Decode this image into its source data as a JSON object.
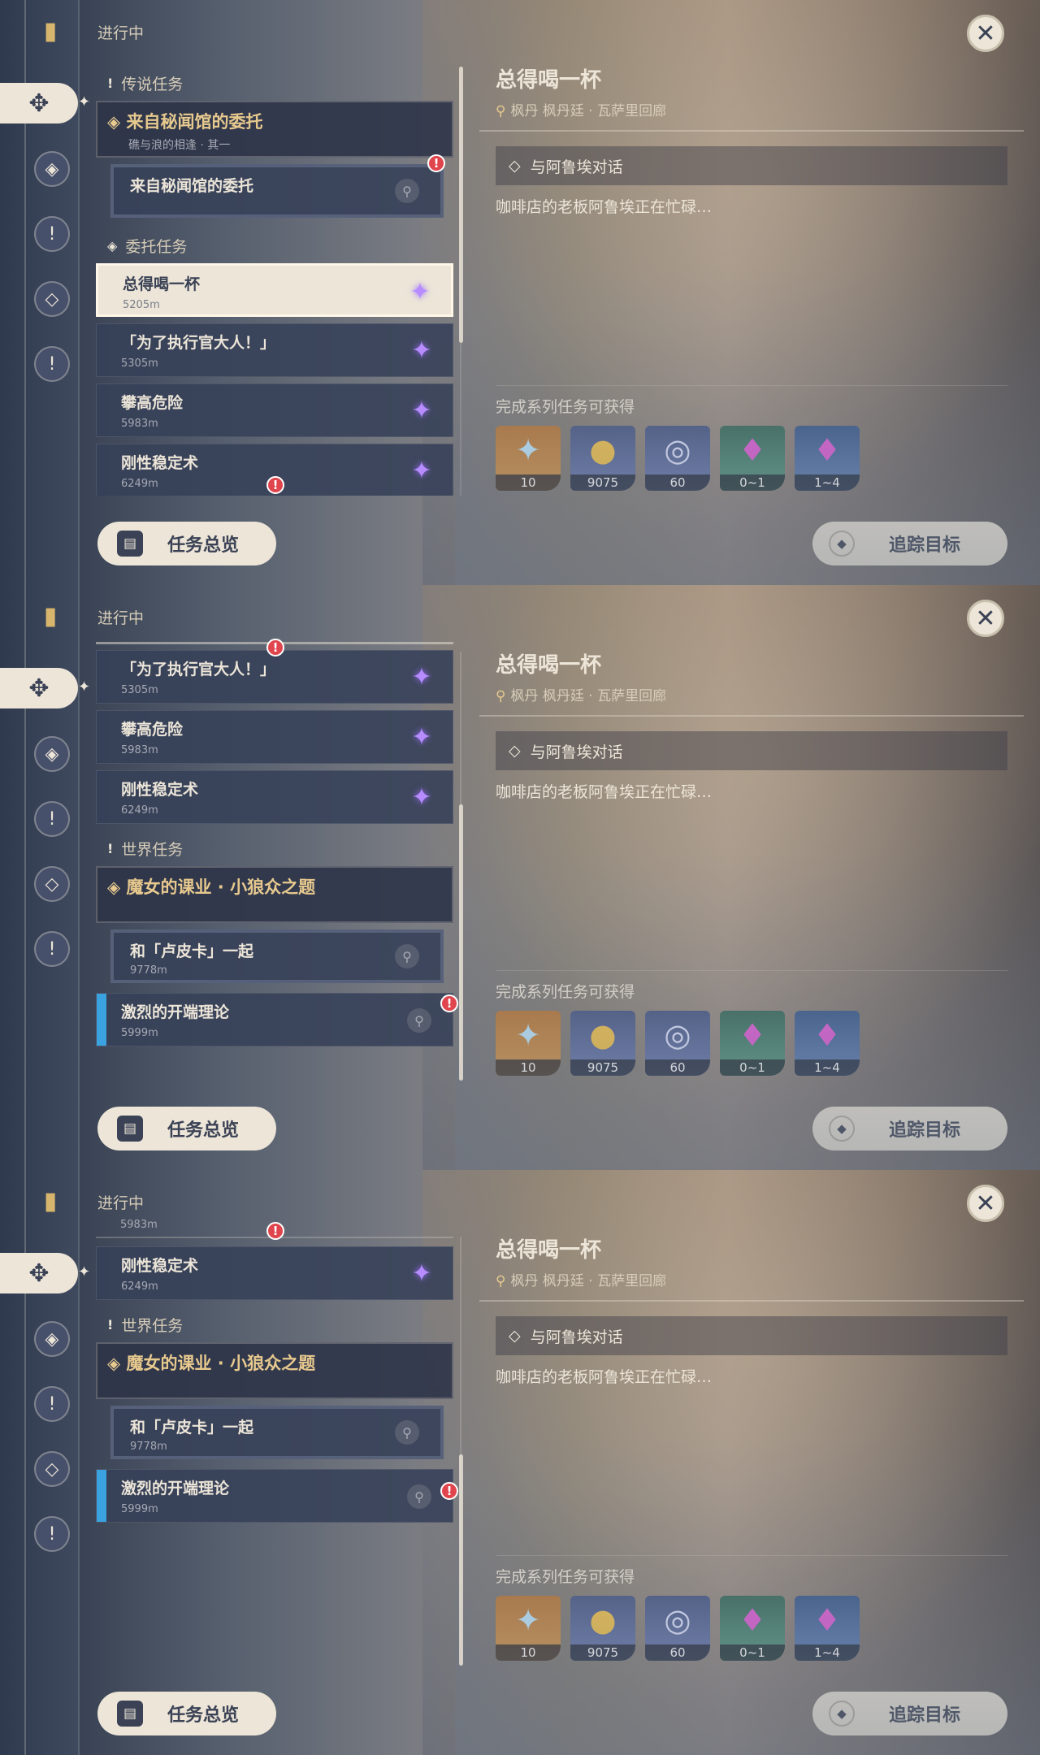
{
  "common": {
    "in_progress_label": "进行中",
    "quest_title": "总得喝一杯",
    "location": "枫丹 枫丹廷 · 瓦萨里回廊",
    "objective": "与阿鲁埃对话",
    "description": "咖啡店的老板阿鲁埃正在忙碌…",
    "rewards_label": "完成系列任务可获得",
    "rewards": [
      {
        "icon": "primogem-icon",
        "count": "10"
      },
      {
        "icon": "mora-icon",
        "count": "9075"
      },
      {
        "icon": "exp-icon",
        "count": "60"
      },
      {
        "icon": "crystal-icon",
        "count": "0~1"
      },
      {
        "icon": "crystal-cluster-icon",
        "count": "1~4"
      }
    ],
    "overview_button": "任务总览",
    "track_button": "追踪目标"
  },
  "frame1": {
    "section_legend": "传说任务",
    "legend_quest_title": "来自秘闻馆的委托",
    "legend_quest_sub": "礁与浪的相逢 · 其一",
    "legend_sub_quest": "来自秘闻馆的委托",
    "section_commission": "委托任务",
    "commissions": [
      {
        "title": "总得喝一杯",
        "distance": "5205m"
      },
      {
        "title": "「为了执行官大人！」",
        "distance": "5305m"
      },
      {
        "title": "攀高危险",
        "distance": "5983m"
      },
      {
        "title": "刚性稳定术",
        "distance": "6249m"
      }
    ]
  },
  "frame2": {
    "commissions": [
      {
        "title": "「为了执行官大人！」",
        "distance": "5305m"
      },
      {
        "title": "攀高危险",
        "distance": "5983m"
      },
      {
        "title": "刚性稳定术",
        "distance": "6249m"
      }
    ],
    "section_world": "世界任务",
    "world_quest_title": "魔女的课业 · 小狼众之题",
    "world_sub": {
      "title": "和「卢皮卡」一起",
      "distance": "9778m"
    },
    "world_other": {
      "title": "激烈的开端理论",
      "distance": "5999m"
    }
  },
  "frame3": {
    "partial_distance": "5983m",
    "commission": {
      "title": "刚性稳定术",
      "distance": "6249m"
    },
    "section_world": "世界任务",
    "world_quest_title": "魔女的课业 · 小狼众之题",
    "world_sub": {
      "title": "和「卢皮卡」一起",
      "distance": "9778m"
    },
    "world_other": {
      "title": "激烈的开端理论",
      "distance": "5999m"
    }
  }
}
